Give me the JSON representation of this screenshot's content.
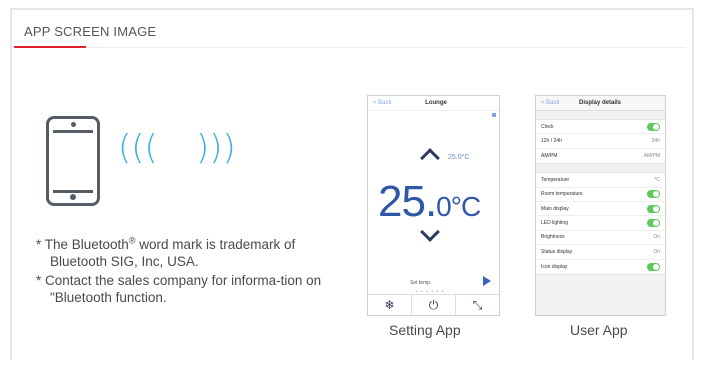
{
  "section": {
    "title": "APP SCREEN IMAGE"
  },
  "notes": {
    "note1_main": "* The Bluetooth",
    "note1_reg": "®",
    "note1_rest": " word mark is trademark of Bluetooth SIG, Inc, USA.",
    "note2": "* Contact the sales company for informa-tion on \"Bluetooth function."
  },
  "icons": {
    "phone": "smartphone-icon",
    "signal_left": "signal-wave-left-icon",
    "signal_right": "signal-wave-right-icon"
  },
  "colors": {
    "accent": "#e0232b",
    "wave": "#38b0ea",
    "temp": "#2f56a8",
    "toggle_on": "#5cc95a"
  },
  "setting_app": {
    "caption": "Setting App",
    "top_back": "< Back",
    "top_title": "Lounge",
    "set_temp_readout": "25.0°C",
    "temp_main": "25.",
    "temp_decimal": "0",
    "temp_unit": "°C",
    "set_label": "Set temp.",
    "pager": "• • • • • •",
    "bar_icons": [
      "fan-icon",
      "power-icon",
      "expand-icon"
    ],
    "bar_glyphs": [
      "❄",
      "⏻",
      "⤡"
    ]
  },
  "user_app": {
    "caption": "User App",
    "top_back": "< Back",
    "top_title": "Display details",
    "group1": [
      {
        "label": "Clock",
        "toggle": true
      },
      {
        "label": "12h / 24h",
        "value": "24h"
      },
      {
        "label": "AM/PM",
        "value": "AM/PM"
      }
    ],
    "group2": [
      {
        "label": "Temperature",
        "value": "°C"
      },
      {
        "label": "Room temperature",
        "toggle": true
      },
      {
        "label": "Main display",
        "toggle": true
      },
      {
        "label": "LED lighting",
        "toggle": true
      },
      {
        "label": "Brightness",
        "value": "On"
      },
      {
        "label": "Status display",
        "value": "On"
      },
      {
        "label": "Icon display",
        "toggle": true
      }
    ]
  }
}
